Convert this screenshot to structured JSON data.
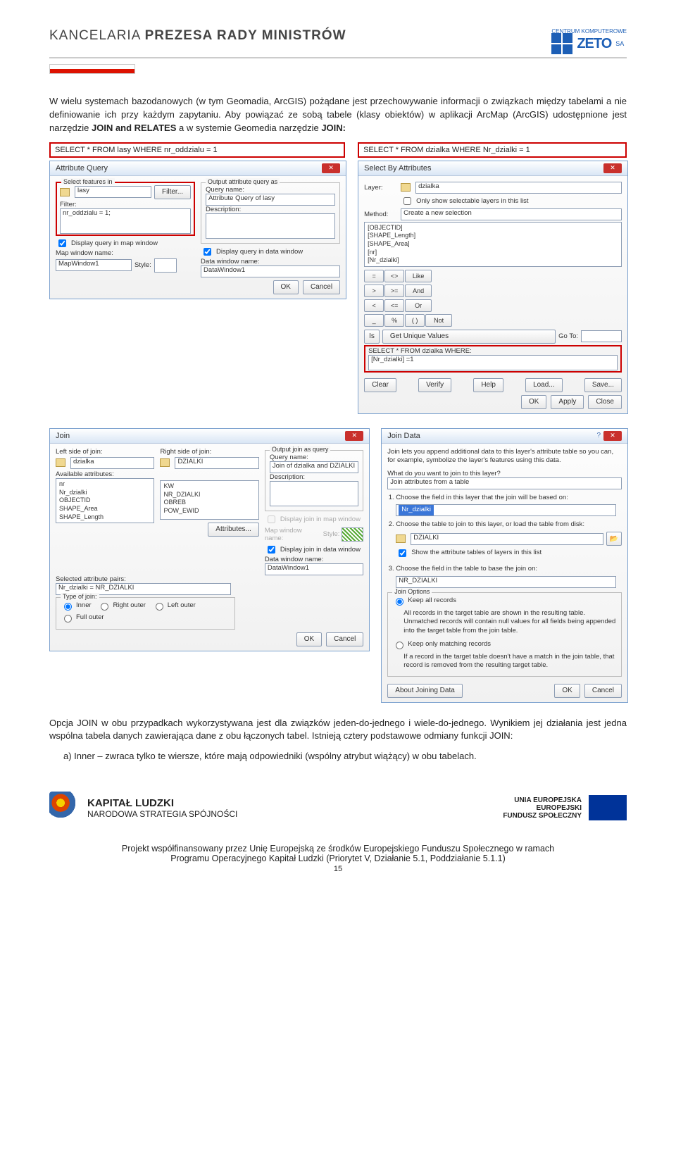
{
  "header": {
    "gov1": "KANCELARIA ",
    "gov2": "PREZESA RADY MINISTRÓW",
    "zeto_top": "CENTRUM KOMPUTEROWE",
    "zeto": "ZETO",
    "zeto_sa": "SA"
  },
  "text": {
    "p1": "W wielu systemach bazodanowych (w tym Geomadia, ArcGIS) pożądane jest przechowywanie informacji o związkach między tabelami a nie definiowanie ich przy każdym zapytaniu. Aby powiązać ze sobą tabele (klasy obiektów) w aplikacji ArcMap (ArcGIS) udostępnione jest narzędzie ",
    "p1b1": "JOIN and RELATES",
    "p1m": "  a w systemie Geomedia narzędzie  ",
    "p1b2": "JOIN:",
    "p2": "Opcja JOIN w obu przypadkach wykorzystywana jest dla związków jeden-do-jednego i wiele-do-jednego. Wynikiem jej działania jest jedna wspólna tabela danych zawierająca dane z obu łączonych tabel. Istnieją cztery podstawowe odmiany funkcji JOIN:",
    "li_a": "a)   Inner – zwraca tylko te wiersze, które mają odpowiedniki (wspólny atrybut wiążący) w obu tabelach."
  },
  "q": {
    "left": "SELECT * FROM lasy WHERE nr_oddzialu = 1",
    "right": "SELECT * FROM dzialka WHERE Nr_dzialki = 1"
  },
  "aq": {
    "title": "Attribute Query",
    "sel_feat": "Select features in",
    "layer": "lasy",
    "filter_btn": "Filter...",
    "filter_lbl": "Filter:",
    "filter_val": "nr_oddzialu = 1;",
    "out_q": "Output attribute query as",
    "qname": "Query name:",
    "qname_v": "Attribute Query of lasy",
    "desc": "Description:",
    "disp_map": "Display query in map window",
    "map_name": "Map window name:",
    "map_v": "MapWindow1",
    "style": "Style:",
    "disp_data": "Display query in data window",
    "data_name": "Data window name:",
    "data_v": "DataWindow1",
    "ok": "OK",
    "cancel": "Cancel"
  },
  "sba": {
    "title": "Select By Attributes",
    "layer": "Layer:",
    "layer_v": "dzialka",
    "only": "Only show selectable layers in this list",
    "method": "Method:",
    "method_v": "Create a new selection",
    "fields": "[OBJECTID]\n[SHAPE_Length]\n[SHAPE_Area]\n[nr]\n[Nr_dzialki]",
    "ops": [
      "=",
      "<>",
      "Like",
      ">",
      ">=",
      "And",
      "<",
      "<=",
      "Or",
      "_",
      "%",
      "(  )",
      "Not"
    ],
    "is": "Is",
    "guv": "Get Unique Values",
    "goto": "Go To:",
    "from": "SELECT * FROM dzialka WHERE:",
    "where": "[Nr_dzialki] =1",
    "clear": "Clear",
    "verify": "Verify",
    "help": "Help",
    "load": "Load...",
    "save": "Save...",
    "ok": "OK",
    "apply": "Apply",
    "close": "Close"
  },
  "join": {
    "title": "Join",
    "lside": "Left side of join:",
    "lval": "dzialka",
    "avail": "Available attributes:",
    "lattrs": "nr\nNr_dzialki\nOBJECTID\nSHAPE_Area\nSHAPE_Length",
    "rside": "Right side of join:",
    "rval": "DZIALKI",
    "rattrs": "KW\nNR_DZIALKI\nOBREB\nPOW_EWID",
    "attrbtn": "Attributes...",
    "selpair": "Selected attribute pairs:",
    "pair": "Nr_dzialki = NR_DZIALKI",
    "type": "Type of join:",
    "inner": "Inner",
    "ro": "Right outer",
    "lo": "Left outer",
    "fo": "Full outer",
    "out": "Output join as query",
    "qname": "Query name:",
    "qval": "Join of dzialka and DZIALKI",
    "desc": "Description:",
    "dmap": "Display join in map window",
    "mwin": "Map window name:",
    "style": "Style:",
    "ddata": "Display join in data window",
    "dwin": "Data window name:",
    "dval": "DataWindow1",
    "ok": "OK",
    "cancel": "Cancel"
  },
  "jd": {
    "title": "Join Data",
    "intro": "Join lets you append additional data to this layer's attribute table so you can, for example, symbolize the layer's features using this data.",
    "what": "What do you want to join to this layer?",
    "what_v": "Join attributes from a table",
    "s1": "Choose the field in this layer that the join will be based on:",
    "s1v": "Nr_dzialki",
    "s2": "Choose the table to join to this layer, or load the table from disk:",
    "s2v": "DZIALKI",
    "s2chk": "Show the attribute tables of layers in this list",
    "s3": "Choose the field in the table to base the join on:",
    "s3v": "NR_DZIALKI",
    "jopt": "Join Options",
    "keepall": "Keep all records",
    "keepall_d": "All records in the target table are shown in the resulting table. Unmatched records will contain null values for all fields being appended into the target table from the join table.",
    "match": "Keep only matching records",
    "match_d": "If a record in the target table doesn't have a match in the join table, that record is removed from the resulting target table.",
    "about": "About Joining Data",
    "ok": "OK",
    "cancel": "Cancel"
  },
  "footer": {
    "kl_b": "KAPITAŁ LUDZKI",
    "kl_s": "NARODOWA STRATEGIA SPÓJNOŚCI",
    "eu1": "UNIA EUROPEJSKA",
    "eu2": "EUROPEJSKI",
    "eu3": "FUNDUSZ SPOŁECZNY",
    "line1": "Projekt współfinansowany przez Unię Europejską ze środków Europejskiego Funduszu Społecznego w ramach",
    "line2": "Programu Operacyjnego Kapitał Ludzki (Priorytet V, Działanie 5.1, Poddziałanie 5.1.1)",
    "page": "15"
  }
}
